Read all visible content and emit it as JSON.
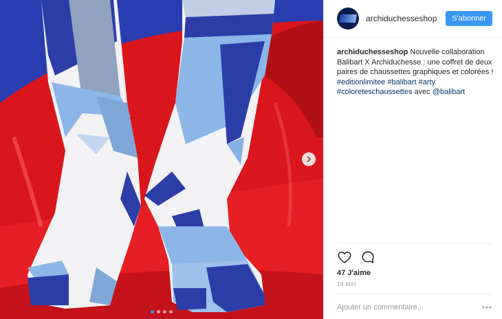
{
  "post": {
    "username": "archiduchesseshop",
    "follow_label": "S'abonner",
    "caption": {
      "username": "archiduchesseshop",
      "text": "Nouvelle collaboration Balibart X Archiduchesse : une coffret de deux paires de chaussettes graphiques et colorées !",
      "hashtags": [
        "#editionlimitee",
        "#balibart",
        "#arty",
        "#coloreteschaussettes"
      ],
      "with_text": "avec",
      "mention": "@balibart"
    },
    "likes_label": "47 J'aime",
    "date_label": "19 MAI",
    "comment_placeholder": "Ajouter un commentaire...",
    "icons": {
      "like": "heart-icon",
      "comment": "comment-bubble-icon",
      "next": "chevron-right-icon",
      "more": "more-options-icon"
    },
    "colors": {
      "accent": "#3897f0",
      "link": "#003569",
      "highlight": "#e0141a"
    },
    "carousel": {
      "slide_count": 4,
      "active_index": 0
    }
  }
}
